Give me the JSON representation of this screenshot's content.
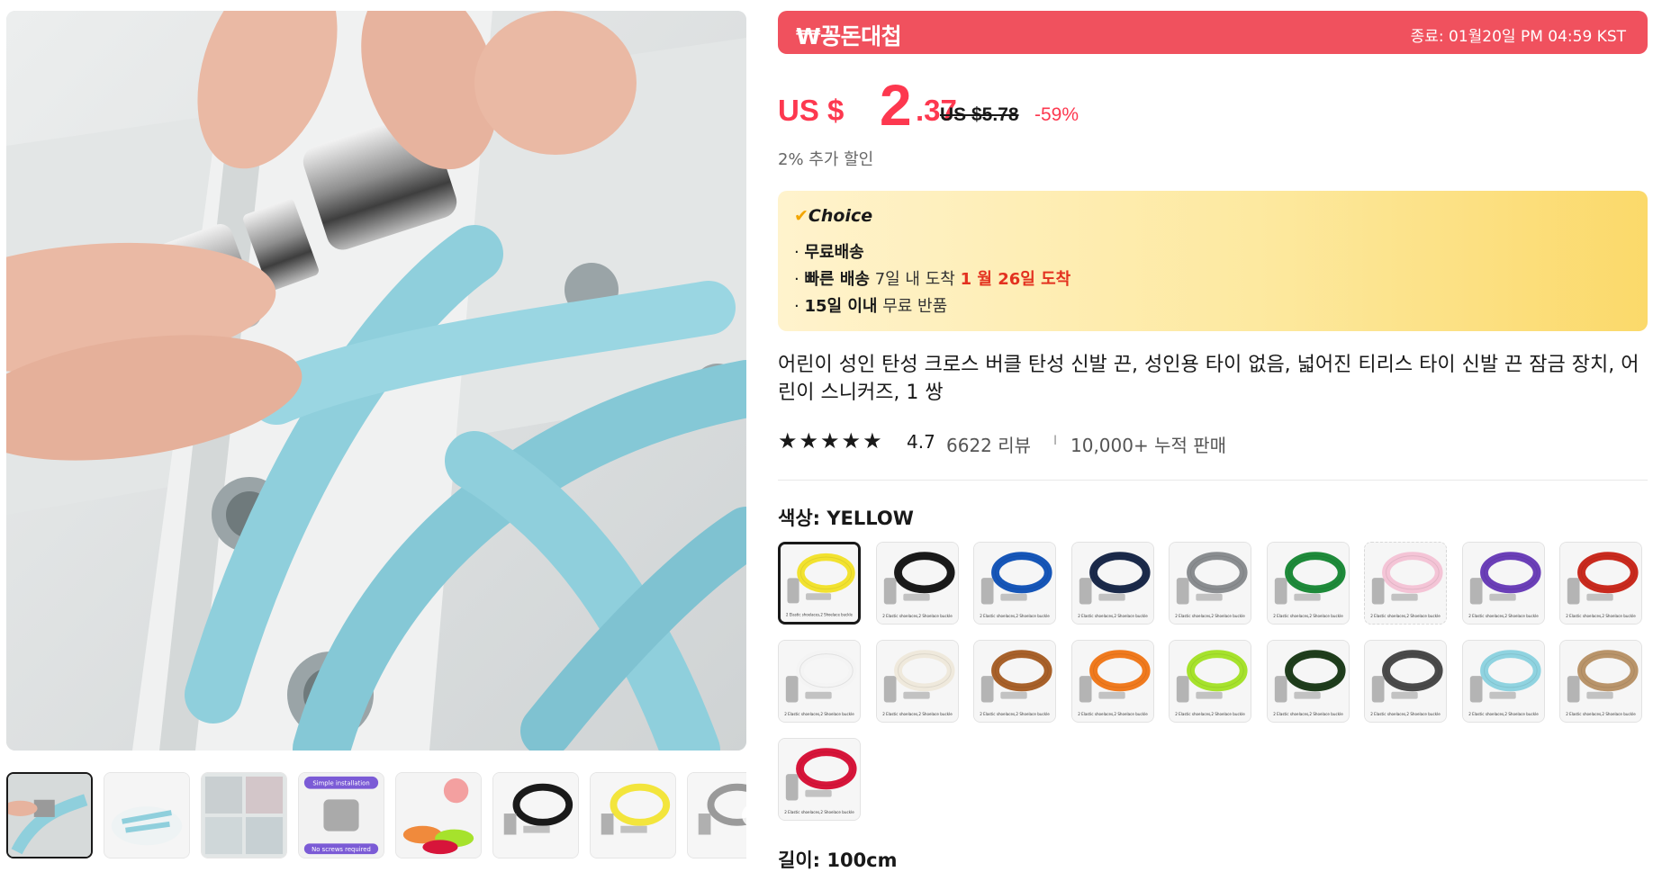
{
  "promo": {
    "logo_text": "₩꽁돈대첩",
    "end_text": "종료: 01월20일 PM 04:59 KST",
    "color": "#f0515e"
  },
  "price": {
    "currency": "US $",
    "integer": "2",
    "decimal": ".37",
    "original": "US $5.78",
    "discount": "-59%",
    "extra_discount": "2% 추가 할인",
    "color": "#fd384f"
  },
  "choice": {
    "badge": "Choice",
    "badge_icon": "check-icon",
    "free_shipping": "무료배송",
    "fast_label": "빠른 배송",
    "fast_mid": "7일 내 도착",
    "fast_date": "1 월 26일 도착",
    "return_label": "15일 이내",
    "return_text": "무료 반품"
  },
  "product": {
    "title": "어린이 성인 탄성 크로스 버클 탄성 신발 끈, 성인용 타이 없음, 넓어진 티리스 타이 신발 끈 잠금 장치, 어린이 스니커즈, 1 쌍",
    "rating": "4.7",
    "rating_stars": 4.7,
    "reviews": "6622 리뷰",
    "separator": "I",
    "sold": "10,000+ 누적 판매"
  },
  "gallery": {
    "thumbs": [
      {
        "name": "thumb-1",
        "lace": "#8fcfdc"
      },
      {
        "name": "thumb-2",
        "lace": "#8fcfdc"
      },
      {
        "name": "thumb-3",
        "lace": "#b6c0c4"
      },
      {
        "name": "thumb-4",
        "lace": "#7b5bd6"
      },
      {
        "name": "thumb-5",
        "lace": "#f08a3c"
      },
      {
        "name": "thumb-6",
        "lace": "#1a1a1a"
      },
      {
        "name": "thumb-7",
        "lace": "#f3e53c"
      },
      {
        "name": "thumb-8",
        "lace": "#9a9a9a"
      }
    ],
    "thumb_text_4_top": "Simple installation",
    "thumb_text_4_bottom": "No screws required",
    "next_icon": "chevron-right-icon"
  },
  "options": {
    "color_label": "색상: YELLOW",
    "colors": [
      {
        "name": "yellow",
        "hex": "#f2e22f"
      },
      {
        "name": "black",
        "hex": "#1a1a1a"
      },
      {
        "name": "blue",
        "hex": "#1656b8"
      },
      {
        "name": "navy",
        "hex": "#1b2a4a"
      },
      {
        "name": "gray",
        "hex": "#8a8d90"
      },
      {
        "name": "green",
        "hex": "#1e8a3a"
      },
      {
        "name": "pink",
        "hex": "#f4c4d6"
      },
      {
        "name": "purple",
        "hex": "#6b3fb8"
      },
      {
        "name": "red",
        "hex": "#c92a1e"
      },
      {
        "name": "white",
        "hex": "#f4f4f4"
      },
      {
        "name": "beige",
        "hex": "#efe9dc"
      },
      {
        "name": "brown",
        "hex": "#a8612a"
      },
      {
        "name": "orange",
        "hex": "#f07a1e"
      },
      {
        "name": "lime",
        "hex": "#a6e22c"
      },
      {
        "name": "dark-green",
        "hex": "#1f3d1c"
      },
      {
        "name": "dark-gray",
        "hex": "#4a4a4a"
      },
      {
        "name": "sky-blue",
        "hex": "#8fd3e0"
      },
      {
        "name": "khaki",
        "hex": "#b9946a"
      },
      {
        "name": "crimson",
        "hex": "#d7153a"
      }
    ],
    "swatch_caption": "2 Elastic shoelaces,2 Shoelace buckle",
    "selected_index": 0,
    "length_label": "길이: 100cm"
  }
}
